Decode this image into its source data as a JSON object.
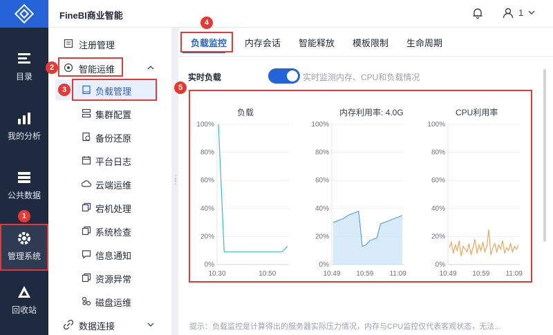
{
  "app": {
    "title": "FineBI商业智能"
  },
  "header": {
    "user_label": "1"
  },
  "nav": {
    "items": [
      {
        "label": "目录",
        "icon": "catalog-icon"
      },
      {
        "label": "我的分析",
        "icon": "analysis-icon"
      },
      {
        "label": "公共数据",
        "icon": "database-icon"
      },
      {
        "label": "管理系统",
        "icon": "gear-icon",
        "active": true
      },
      {
        "label": "回收站",
        "icon": "recycle-icon"
      }
    ]
  },
  "sidebar": {
    "items": [
      {
        "label": "注册管理",
        "icon": "register-icon"
      },
      {
        "label": "智能运维",
        "icon": "smart-ops-icon",
        "expanded": true
      },
      {
        "label": "负载管理",
        "icon": "load-icon",
        "selected": true
      },
      {
        "label": "集群配置",
        "icon": "cluster-icon"
      },
      {
        "label": "备份还原",
        "icon": "backup-icon"
      },
      {
        "label": "平台日志",
        "icon": "log-icon"
      },
      {
        "label": "云端运维",
        "icon": "cloud-icon"
      },
      {
        "label": "宕机处理",
        "icon": "crash-icon"
      },
      {
        "label": "系统检查",
        "icon": "check-icon"
      },
      {
        "label": "信息通知",
        "icon": "message-icon"
      },
      {
        "label": "资源异常",
        "icon": "resource-icon"
      },
      {
        "label": "磁盘运维",
        "icon": "disk-icon"
      },
      {
        "label": "数据连接",
        "icon": "link-icon"
      }
    ]
  },
  "tabs": [
    {
      "label": "负载监控",
      "active": true
    },
    {
      "label": "内存会话"
    },
    {
      "label": "智能释放"
    },
    {
      "label": "模板限制"
    },
    {
      "label": "生命周期"
    }
  ],
  "monitor": {
    "realtime_label": "实时负载",
    "toggle_on": true,
    "toggle_desc": "实时监测内存、CPU和负载情况",
    "hint": "提示：负载监控是计算得出的服务器实际压力情况，内存与CPU监控仅代表客观状态，无法..."
  },
  "annotations": [
    "1",
    "2",
    "3",
    "4",
    "5"
  ],
  "colors": {
    "accent": "#2563d8",
    "annotation": "#e53935",
    "load_line": "#3bb8d8",
    "mem_line": "#4ea7e6",
    "cpu_line": "#f5a35c"
  },
  "chart_data": [
    {
      "type": "line",
      "title": "负载",
      "x_ticks": [
        "10:30",
        "10:50"
      ],
      "y_ticks": [
        "100%",
        "80%",
        "60%",
        "40%",
        "20%",
        "0%"
      ],
      "ylim": [
        0,
        100
      ],
      "series": [
        {
          "values": [
            100,
            9,
            9,
            9,
            9,
            9,
            9,
            9,
            9,
            9,
            9,
            9,
            13
          ]
        }
      ]
    },
    {
      "type": "area",
      "title": "内存利用率: 4.0G",
      "x_ticks": [
        "10:49",
        "10:59",
        "11:09"
      ],
      "y_ticks": [
        "100%",
        "80%",
        "60%",
        "40%",
        "20%",
        "0%"
      ],
      "ylim": [
        0,
        100
      ],
      "series": [
        {
          "values": [
            30,
            31,
            32,
            33,
            35,
            36,
            37,
            38,
            13,
            14,
            17,
            18,
            19,
            29,
            30,
            31,
            32,
            33,
            34,
            35
          ]
        }
      ]
    },
    {
      "type": "line",
      "title": "CPU利用率",
      "x_ticks": [
        "10:49",
        "10:59",
        "11:09"
      ],
      "y_ticks": [
        "100%",
        "80%",
        "60%",
        "40%",
        "20%",
        "0%"
      ],
      "ylim": [
        0,
        100
      ],
      "series": [
        {
          "values": [
            12,
            16,
            8,
            14,
            10,
            17,
            6,
            13,
            11,
            9,
            15,
            7,
            12,
            18,
            8,
            14,
            10,
            16,
            9,
            13,
            25,
            7,
            12,
            15,
            9,
            14,
            11,
            17,
            8,
            12,
            10,
            15,
            9,
            13,
            11,
            14
          ]
        }
      ]
    }
  ]
}
